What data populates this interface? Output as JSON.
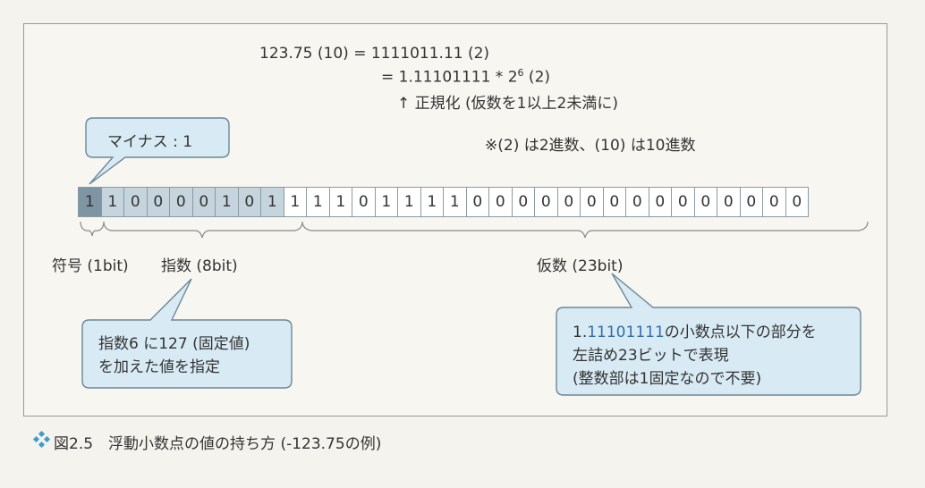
{
  "formula": {
    "line1": "123.75 (10) = 1111011.11 (2)",
    "line2_pre": "= 1.11101111 * 2",
    "line2_sup": "6",
    "line2_post": " (2)",
    "line3": "↑ 正規化 (仮数を1以上2未満に)"
  },
  "note": "※(2) は2進数、(10) は10進数",
  "callouts": {
    "sign": "マイナス : 1",
    "exponent_line1": "指数6 に127 (固定値)",
    "exponent_line2": "を加えた値を指定",
    "mantissa_line1_pre": "1.",
    "mantissa_line1_blue": "11101111",
    "mantissa_line1_post": "の小数点以下の部分を",
    "mantissa_line2": "左詰め23ビットで表現",
    "mantissa_line3": "(整数部は1固定なので不要)"
  },
  "bits": {
    "sign": [
      "1"
    ],
    "exponent": [
      "1",
      "0",
      "0",
      "0",
      "0",
      "1",
      "0",
      "1"
    ],
    "mantissa": [
      "1",
      "1",
      "1",
      "0",
      "1",
      "1",
      "1",
      "1",
      "0",
      "0",
      "0",
      "0",
      "0",
      "0",
      "0",
      "0",
      "0",
      "0",
      "0",
      "0",
      "0",
      "0",
      "0"
    ]
  },
  "labels": {
    "sign": "符号 (1bit)",
    "exponent": "指数 (8bit)",
    "mantissa": "仮数 (23bit)"
  },
  "caption": {
    "icon": "diamond-cluster-icon",
    "text": "図2.5　浮動小数点の値の持ち方 (-123.75の例)"
  },
  "colors": {
    "sign_cell": "#7e95a4",
    "exponent_cell": "#c6d4dd",
    "mantissa_cell": "#ffffff",
    "callout_fill": "#d8eaf4",
    "callout_stroke": "#6b8898",
    "highlight_blue": "#2f6ea8",
    "caption_icon": "#3d9bd0"
  }
}
